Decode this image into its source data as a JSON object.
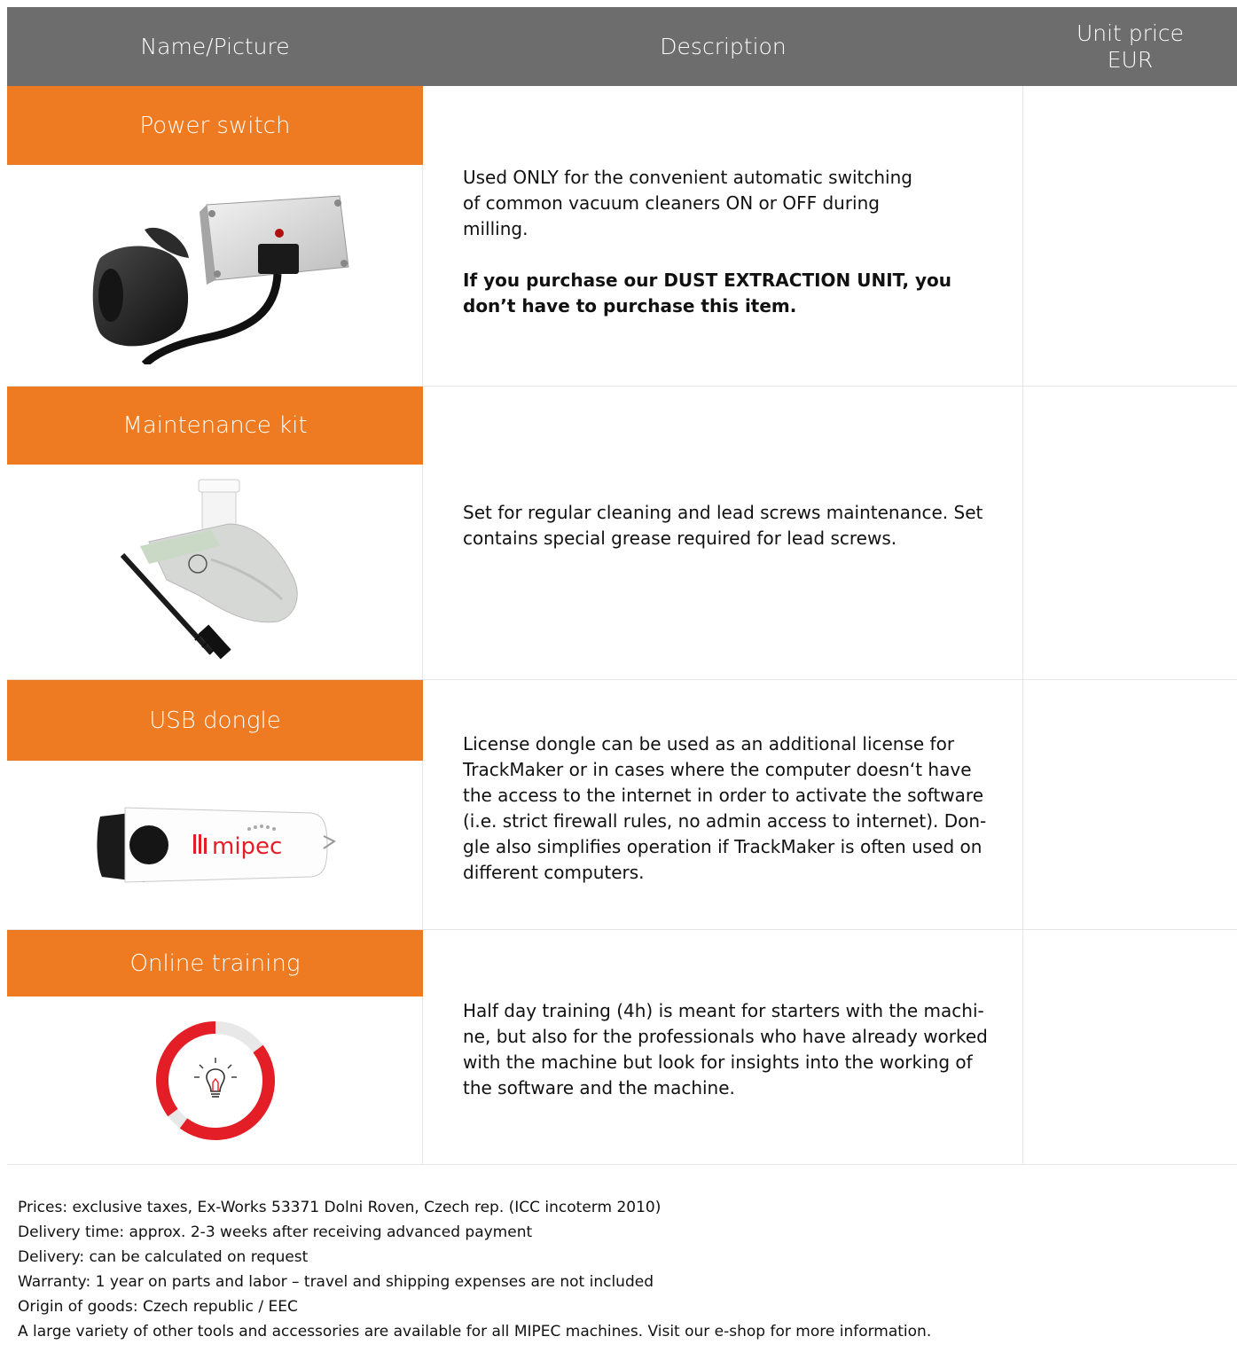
{
  "header": {
    "name_label": "Name/Picture",
    "desc_label": "Description",
    "price_label_line1": "Unit price",
    "price_label_line2": "EUR"
  },
  "items": [
    {
      "name": "Power switch",
      "picture_icon": "power-switch-image",
      "desc_lines": [
        "Used ONLY for the convenient automatic switching",
        "of common vacuum cleaners ON or OFF during",
        "milling."
      ],
      "desc_bold_lines": [
        "If you purchase our DUST EXTRACTION UNIT, you",
        "don’t have to purchase this item."
      ],
      "price": ""
    },
    {
      "name": "Maintenance kit",
      "picture_icon": "maintenance-kit-image",
      "desc_lines": [
        "Set for regular cleaning and lead screws maintenance. Set",
        "contains special grease required for lead screws."
      ],
      "price": ""
    },
    {
      "name": "USB dongle",
      "picture_icon": "usb-dongle-image",
      "logo_text": "mipec",
      "desc_lines": [
        "License dongle can be used as an additional license for",
        "TrackMaker or in cases where the computer doesn‘t have",
        "the access to the internet in order to activate the software",
        "(i.e. strict firewall rules, no admin access to internet). Don-",
        "gle also simplifies operation if TrackMaker is often used on",
        "different computers."
      ],
      "price": ""
    },
    {
      "name": "Online training",
      "picture_icon": "lightbulb-icon",
      "desc_lines": [
        "Half day training (4h) is meant for starters with the machi-",
        "ne, but also for the professionals who have already worked",
        "with the machine but look for insights into the working of",
        "the software and the machine."
      ],
      "price": ""
    }
  ],
  "footer": [
    "Prices: exclusive taxes, Ex-Works 53371 Dolni Roven, Czech rep. (ICC incoterm 2010)",
    "Delivery time: approx. 2-3 weeks after receiving advanced payment",
    "Delivery: can be calculated on request",
    "Warranty: 1 year on parts and labor – travel and shipping expenses are not included",
    "Origin of goods: Czech republic / EEC",
    "A large variety of other tools and accessories are available for all MIPEC machines. Visit our e-shop for more information."
  ],
  "colors": {
    "header_bg": "#6d6d6d",
    "accent_orange": "#ee7a22",
    "logo_red": "#e41e26"
  }
}
